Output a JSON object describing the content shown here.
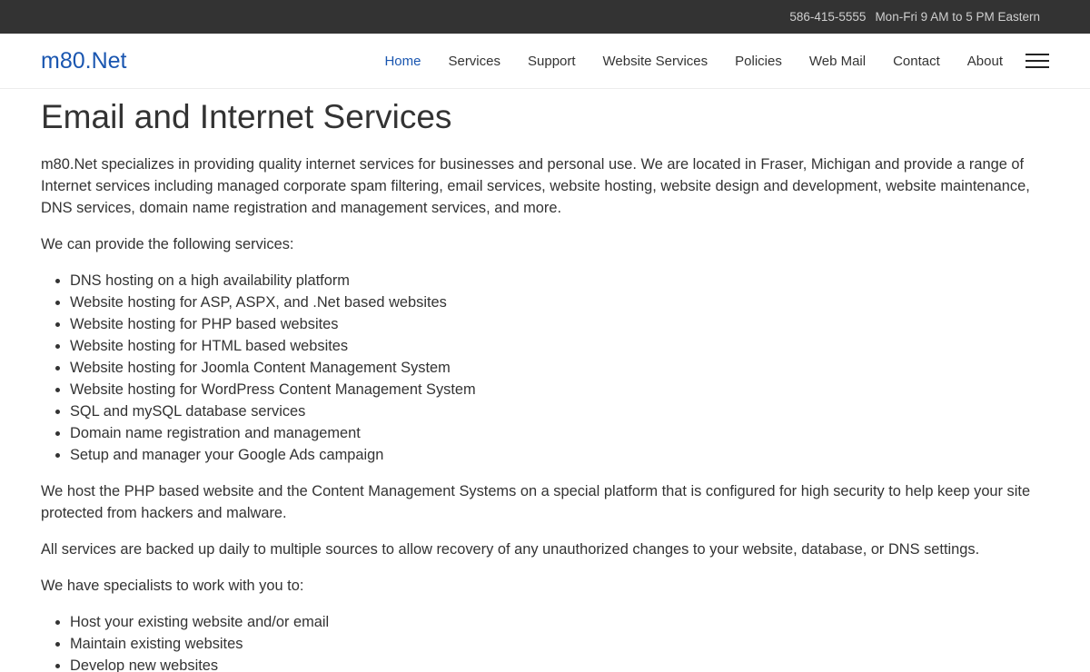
{
  "topbar": {
    "phone": "586-415-5555",
    "hours": "Mon-Fri 9 AM to 5 PM Eastern"
  },
  "header": {
    "brand": "m80.Net",
    "nav": [
      {
        "label": "Home",
        "active": true
      },
      {
        "label": "Services"
      },
      {
        "label": "Support"
      },
      {
        "label": "Website Services"
      },
      {
        "label": "Policies"
      },
      {
        "label": "Web Mail"
      },
      {
        "label": "Contact"
      },
      {
        "label": "About"
      }
    ],
    "menu_icon": "hamburger-menu-icon"
  },
  "main": {
    "title": "Email and Internet Services",
    "intro": "m80.Net specializes in providing quality internet services for businesses and personal use. We are located in Fraser, Michigan and provide a range of Internet services including managed corporate spam filtering, email services, website hosting, website design and development, website maintenance, DNS services, domain name registration and management services, and more.",
    "services_lead": "We can provide the following services:",
    "services": [
      "DNS hosting on a high availability platform",
      "Website hosting for ASP, ASPX, and .Net based websites",
      "Website hosting for PHP based websites",
      "Website hosting for HTML based websites",
      "Website hosting for Joomla Content Management System",
      "Website hosting for WordPress Content Management System",
      "SQL and mySQL database services",
      "Domain name registration and management",
      "Setup and manager your Google Ads campaign"
    ],
    "security_text": "We host the PHP based website and the Content Management Systems on a special platform that is configured for high security to help keep your site protected from hackers and malware.",
    "backup_text": "All services are backed up daily to multiple sources to allow recovery of any unauthorized changes to your website, database, or DNS settings.",
    "specialists_lead": "We have specialists to work with you to:",
    "specialists": [
      "Host your existing website and/or email",
      "Maintain existing websites",
      "Develop new websites"
    ]
  }
}
